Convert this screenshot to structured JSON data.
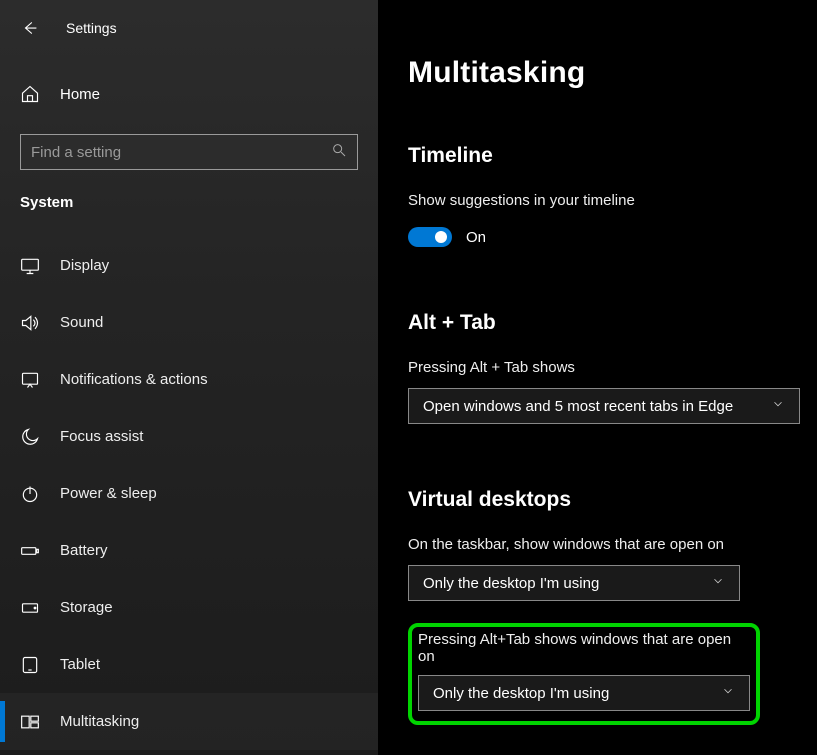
{
  "window": {
    "title": "Settings"
  },
  "sidebar": {
    "home_label": "Home",
    "search_placeholder": "Find a setting",
    "category": "System",
    "items": [
      {
        "label": "Display",
        "icon": "display-icon"
      },
      {
        "label": "Sound",
        "icon": "sound-icon"
      },
      {
        "label": "Notifications & actions",
        "icon": "notifications-icon"
      },
      {
        "label": "Focus assist",
        "icon": "focus-assist-icon"
      },
      {
        "label": "Power & sleep",
        "icon": "power-icon"
      },
      {
        "label": "Battery",
        "icon": "battery-icon"
      },
      {
        "label": "Storage",
        "icon": "storage-icon"
      },
      {
        "label": "Tablet",
        "icon": "tablet-icon"
      },
      {
        "label": "Multitasking",
        "icon": "multitasking-icon"
      }
    ],
    "active_index": 8
  },
  "main": {
    "title": "Multitasking",
    "timeline": {
      "heading": "Timeline",
      "suggestions_label": "Show suggestions in your timeline",
      "toggle_on": true,
      "toggle_state_text": "On"
    },
    "alt_tab": {
      "heading": "Alt + Tab",
      "label": "Pressing Alt + Tab shows",
      "selected": "Open windows and 5 most recent tabs in Edge"
    },
    "virtual_desktops": {
      "heading": "Virtual desktops",
      "taskbar_label": "On the taskbar, show windows that are open on",
      "taskbar_selected": "Only the desktop I'm using",
      "alt_tab_label": "Pressing Alt+Tab shows windows that are open on",
      "alt_tab_selected": "Only the desktop I'm using"
    }
  }
}
